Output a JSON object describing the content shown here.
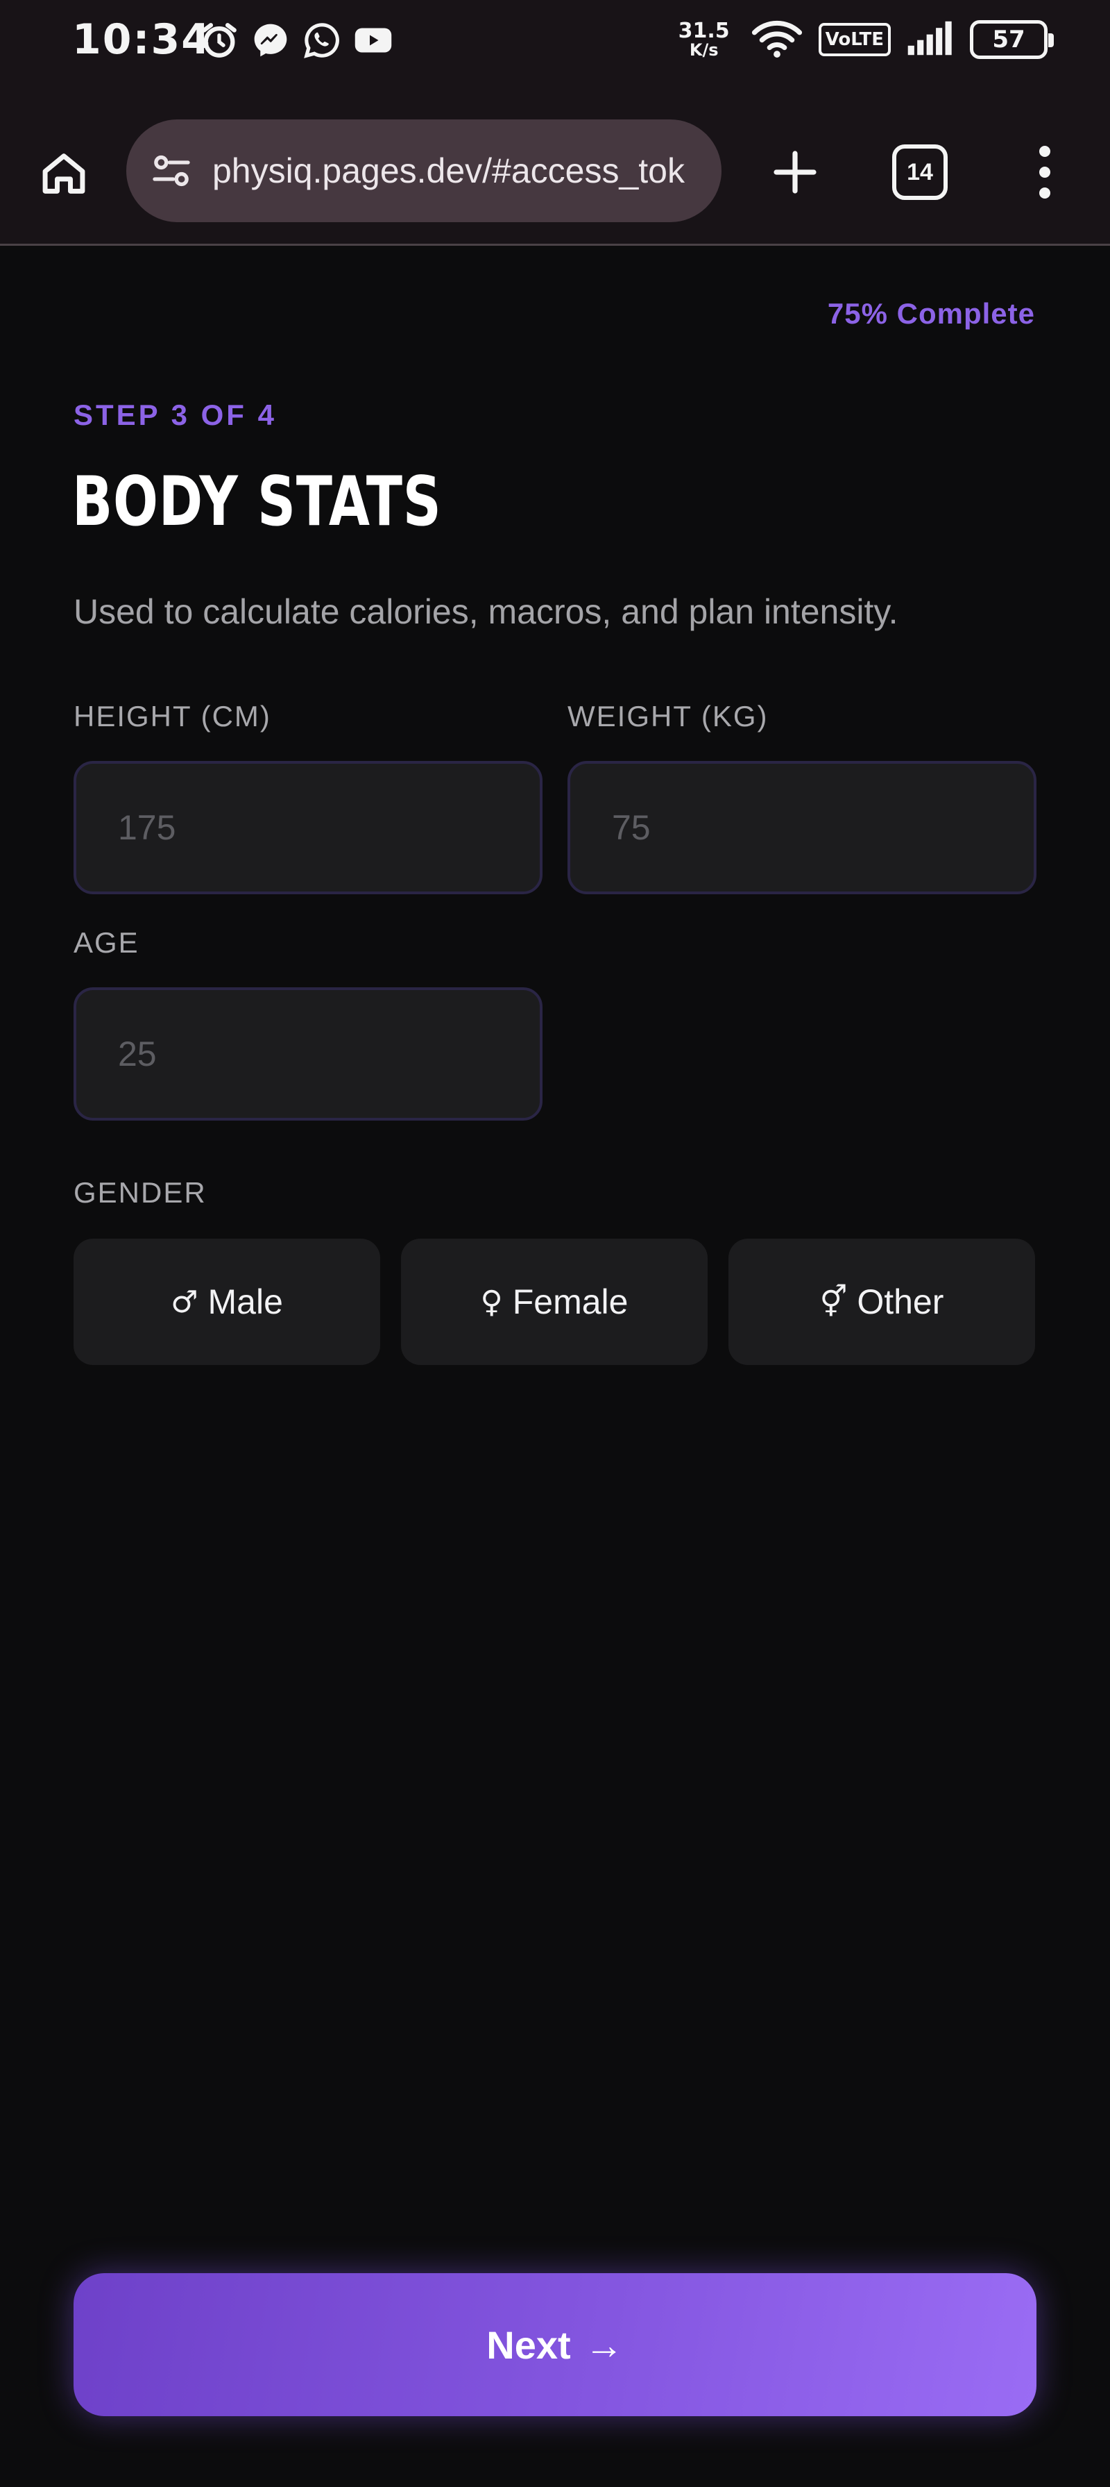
{
  "status_bar": {
    "time": "10:34",
    "net_speed_value": "31.5",
    "net_speed_unit": "K/s",
    "network_label": "VoLTE",
    "battery": "57",
    "icons": [
      "alarm-icon",
      "messenger-icon",
      "whatsapp-icon",
      "youtube-icon",
      "wifi-icon",
      "signal-icon",
      "battery-icon"
    ]
  },
  "browser": {
    "url": "physiq.pages.dev/#access_tok",
    "tab_count": "14",
    "icons": [
      "home-icon",
      "site-settings-icon",
      "plus-icon",
      "tabs-icon",
      "more-vert-icon"
    ]
  },
  "page": {
    "progress": "75% Complete",
    "step": "STEP 3 OF 4",
    "title": "BODY STATS",
    "subtitle": "Used to calculate calories, macros, and plan intensity.",
    "fields": {
      "height": {
        "label": "HEIGHT (CM)",
        "placeholder": "175",
        "value": ""
      },
      "weight": {
        "label": "WEIGHT (KG)",
        "placeholder": "75",
        "value": ""
      },
      "age": {
        "label": "AGE",
        "placeholder": "25",
        "value": ""
      }
    },
    "gender": {
      "label": "GENDER",
      "options": [
        {
          "symbol": "♂",
          "label": "Male"
        },
        {
          "symbol": "♀",
          "label": "Female"
        },
        {
          "symbol": "⚥",
          "label": "Other"
        }
      ]
    },
    "next": {
      "label": "Next",
      "arrow": "→"
    }
  },
  "colors": {
    "accent": "#8c63e6",
    "background": "#0c0c0d",
    "surface": "#1c1c1e",
    "input_border": "#2a2545",
    "chrome": "#181317",
    "url_pill": "#463840"
  }
}
